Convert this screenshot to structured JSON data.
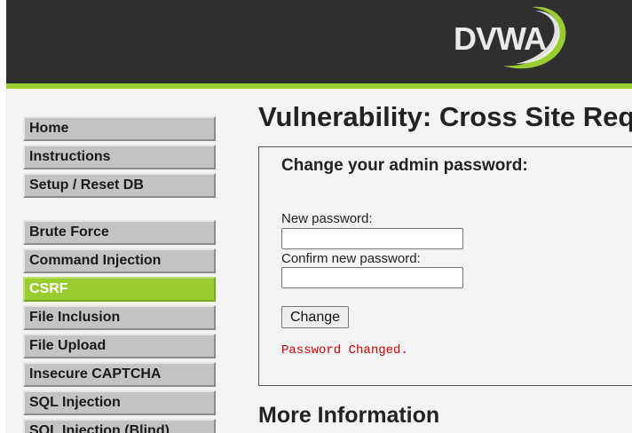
{
  "header": {
    "logo_text": "DVWA",
    "accent_color": "#9acd32",
    "background_color": "#2f2f2f"
  },
  "sidebar": {
    "groups": [
      {
        "items": [
          {
            "label": "Home",
            "selected": false
          },
          {
            "label": "Instructions",
            "selected": false
          },
          {
            "label": "Setup / Reset DB",
            "selected": false
          }
        ]
      },
      {
        "items": [
          {
            "label": "Brute Force",
            "selected": false
          },
          {
            "label": "Command Injection",
            "selected": false
          },
          {
            "label": "CSRF",
            "selected": true
          },
          {
            "label": "File Inclusion",
            "selected": false
          },
          {
            "label": "File Upload",
            "selected": false
          },
          {
            "label": "Insecure CAPTCHA",
            "selected": false
          },
          {
            "label": "SQL Injection",
            "selected": false
          },
          {
            "label": "SQL Injection (Blind)",
            "selected": false
          }
        ]
      }
    ]
  },
  "main": {
    "page_title": "Vulnerability: Cross Site Request Forgery (CSRF)",
    "form": {
      "heading": "Change your admin password:",
      "new_password_label": "New password:",
      "new_password_value": "",
      "confirm_password_label": "Confirm new password:",
      "confirm_password_value": "",
      "submit_label": "Change",
      "status_message": "Password Changed.",
      "status_color": "#cc0000"
    },
    "more_info_heading": "More Information"
  }
}
